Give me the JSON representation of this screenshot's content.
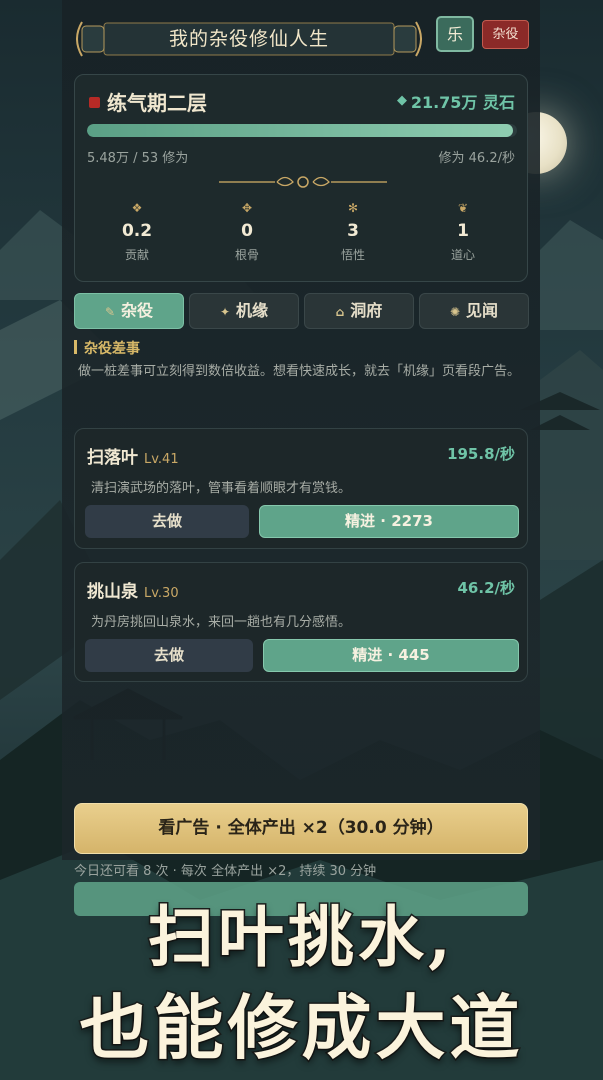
{
  "header": {
    "title": "我的杂役修仙人生",
    "music_label": "乐",
    "chore_label": "杂役"
  },
  "status": {
    "realm": "练气期二层",
    "stone_icon": "spirit-stone-icon",
    "spirit_stones": "21.75万 灵石",
    "progress_fraction": 0.99,
    "cultivation_progress": "5.48万 / 53 修为",
    "cultivation_rate": "修为 46.2/秒",
    "stats": [
      {
        "icon": "contribution-icon",
        "value": "0.2",
        "label": "贡献"
      },
      {
        "icon": "bone-icon",
        "value": "0",
        "label": "根骨"
      },
      {
        "icon": "insight-icon",
        "value": "3",
        "label": "悟性"
      },
      {
        "icon": "heart-icon",
        "value": "1",
        "label": "道心"
      }
    ]
  },
  "tabs": [
    {
      "label": "杂役",
      "icon": "broom-icon",
      "active": true
    },
    {
      "label": "机缘",
      "icon": "sparkle-icon",
      "active": false
    },
    {
      "label": "洞府",
      "icon": "cave-icon",
      "active": false
    },
    {
      "label": "见闻",
      "icon": "scroll-icon",
      "active": false
    }
  ],
  "section": {
    "title": "杂役差事",
    "description": "做一桩差事可立刻得到数倍收益。想看快速成长，就去「机缘」页看段广告。"
  },
  "jobs": [
    {
      "name": "扫落叶",
      "level": "Lv.41",
      "rate": "195.8/秒",
      "desc": "清扫演武场的落叶，管事看着顺眼才有赏钱。",
      "go_label": "去做",
      "upgrade_label": "精进 · 2273"
    },
    {
      "name": "挑山泉",
      "level": "Lv.30",
      "rate": "46.2/秒",
      "desc": "为丹房挑回山泉水，来回一趟也有几分感悟。",
      "go_label": "去做",
      "upgrade_label": "精进 · 445"
    }
  ],
  "ad": {
    "button_label": "看广告 · 全体产出 ×2（30.0 分钟）",
    "note": "今日还可看 8 次 · 每次 全体产出 ×2，持续 30 分钟"
  },
  "promo": {
    "line1": "扫叶挑水,",
    "line2": "也能修成大道"
  },
  "colors": {
    "accent_green": "#5fa48a",
    "gold": "#d5b46a",
    "seal_red": "#b62a26"
  }
}
